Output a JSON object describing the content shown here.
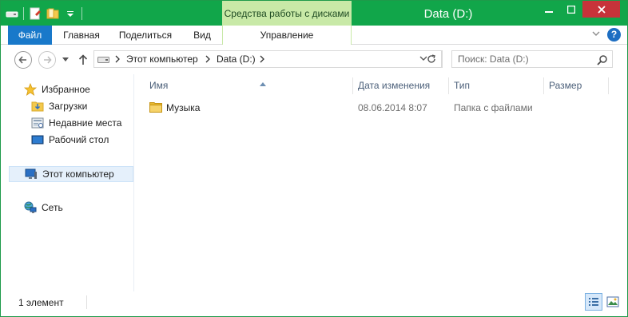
{
  "window": {
    "title": "Data (D:)",
    "context_tab_header": "Средства работы с дисками"
  },
  "ribbon": {
    "tabs": [
      {
        "label": "Файл"
      },
      {
        "label": "Главная"
      },
      {
        "label": "Поделиться"
      },
      {
        "label": "Вид"
      },
      {
        "label": "Управление"
      }
    ]
  },
  "address": {
    "crumbs": [
      "Этот компьютер",
      "Data (D:)"
    ]
  },
  "search": {
    "placeholder": "Поиск: Data (D:)"
  },
  "navpane": {
    "items": [
      {
        "label": "Избранное",
        "icon": "star-icon"
      },
      {
        "label": "Загрузки",
        "icon": "downloads-folder-icon"
      },
      {
        "label": "Недавние места",
        "icon": "recent-places-icon"
      },
      {
        "label": "Рабочий стол",
        "icon": "desktop-icon"
      },
      {
        "label": "Этот компьютер",
        "icon": "computer-icon"
      },
      {
        "label": "Сеть",
        "icon": "network-icon"
      }
    ]
  },
  "columns": {
    "name": "Имя",
    "date": "Дата изменения",
    "type": "Тип",
    "size": "Размер"
  },
  "files": [
    {
      "name": "Музыка",
      "date": "08.06.2014 8:07",
      "type": "Папка с файлами",
      "size": "",
      "icon": "folder-icon"
    }
  ],
  "status": {
    "count": "1 элемент"
  },
  "colors": {
    "titlebar": "#11a64a",
    "context_tab": "#c8e9a7",
    "file_tab": "#1979ca",
    "close_button": "#c7333a"
  }
}
